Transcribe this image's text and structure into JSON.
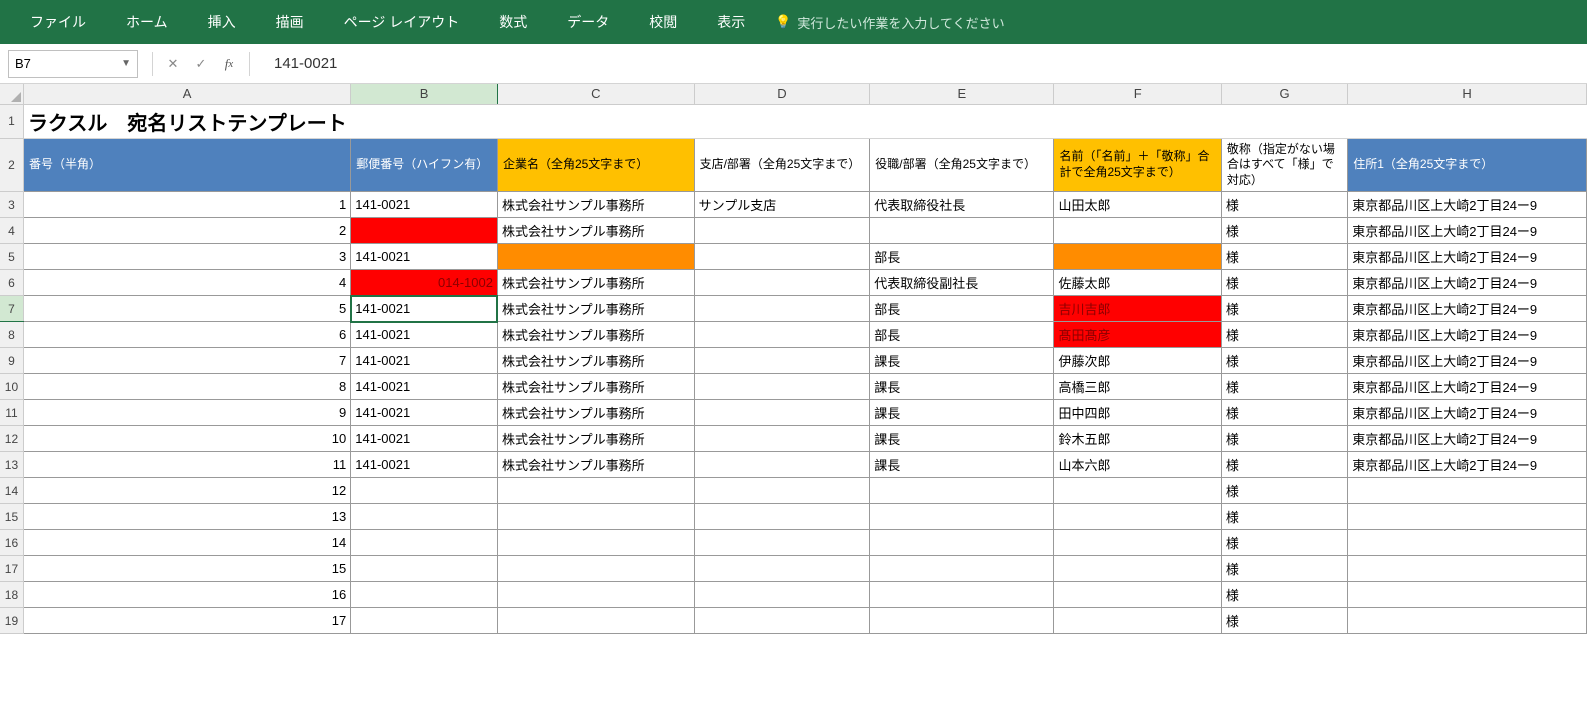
{
  "ribbon": {
    "tabs": [
      "ファイル",
      "ホーム",
      "挿入",
      "描画",
      "ページ レイアウト",
      "数式",
      "データ",
      "校閲",
      "表示"
    ],
    "tellMe": "実行したい作業を入力してください"
  },
  "formulaBar": {
    "nameBox": "B7",
    "formula": "141-0021"
  },
  "columns": [
    "A",
    "B",
    "C",
    "D",
    "E",
    "F",
    "G",
    "H"
  ],
  "selected": {
    "row": 7,
    "col": "B"
  },
  "titleRow": {
    "text": "ラクスル　宛名リストテンプレート"
  },
  "headers": {
    "A": "番号（半角）",
    "B": "郵便番号（ハイフン有）",
    "C": "企業名（全角25文字まで）",
    "D": "支店/部署（全角25文字まで）",
    "E": "役職/部署（全角25文字まで）",
    "F": "名前（「名前」＋「敬称」合計で全角25文字まで）",
    "G": "敬称（指定がない場合はすべて「様」で対応）",
    "H": "住所1（全角25文字まで）"
  },
  "headerStyles": {
    "A": "bg-blue",
    "B": "bg-blue",
    "C": "bg-yellow",
    "D": "",
    "E": "",
    "F": "bg-yellow",
    "G": "",
    "H": "bg-blue"
  },
  "rows": [
    {
      "num": 3,
      "A": "1",
      "B": "141-0021",
      "C": "株式会社サンプル事務所",
      "D": "サンプル支店",
      "E": "代表取締役社長",
      "F": "山田太郎",
      "G": "様",
      "H": "東京都品川区上大崎2丁目24ー9",
      "cls": {}
    },
    {
      "num": 4,
      "A": "2",
      "B": "",
      "C": "株式会社サンプル事務所",
      "D": "",
      "E": "",
      "F": "",
      "G": "様",
      "H": "東京都品川区上大崎2丁目24ー9",
      "cls": {
        "B": "bg-red"
      }
    },
    {
      "num": 5,
      "A": "3",
      "B": "141-0021",
      "C": "",
      "D": "",
      "E": "部長",
      "F": "",
      "G": "様",
      "H": "東京都品川区上大崎2丁目24ー9",
      "cls": {
        "C": "bg-orange",
        "F": "bg-orange"
      }
    },
    {
      "num": 6,
      "A": "4",
      "B": "014-1002",
      "C": "株式会社サンプル事務所",
      "D": "",
      "E": "代表取締役副社長",
      "F": "佐藤太郎",
      "G": "様",
      "H": "東京都品川区上大崎2丁目24ー9",
      "cls": {
        "B": "bg-red txt-darkred right"
      }
    },
    {
      "num": 7,
      "A": "5",
      "B": "141-0021",
      "C": "株式会社サンプル事務所",
      "D": "",
      "E": "部長",
      "F": "吉川吉郎",
      "G": "様",
      "H": "東京都品川区上大崎2丁目24ー9",
      "cls": {
        "F": "bg-red txt-darkred"
      }
    },
    {
      "num": 8,
      "A": "6",
      "B": "141-0021",
      "C": "株式会社サンプル事務所",
      "D": "",
      "E": "部長",
      "F": "髙田髙彦",
      "G": "様",
      "H": "東京都品川区上大崎2丁目24ー9",
      "cls": {
        "F": "bg-red txt-darkred"
      }
    },
    {
      "num": 9,
      "A": "7",
      "B": "141-0021",
      "C": "株式会社サンプル事務所",
      "D": "",
      "E": "課長",
      "F": "伊藤次郎",
      "G": "様",
      "H": "東京都品川区上大崎2丁目24ー9",
      "cls": {}
    },
    {
      "num": 10,
      "A": "8",
      "B": "141-0021",
      "C": "株式会社サンプル事務所",
      "D": "",
      "E": "課長",
      "F": "高橋三郎",
      "G": "様",
      "H": "東京都品川区上大崎2丁目24ー9",
      "cls": {}
    },
    {
      "num": 11,
      "A": "9",
      "B": "141-0021",
      "C": "株式会社サンプル事務所",
      "D": "",
      "E": "課長",
      "F": "田中四郎",
      "G": "様",
      "H": "東京都品川区上大崎2丁目24ー9",
      "cls": {}
    },
    {
      "num": 12,
      "A": "10",
      "B": "141-0021",
      "C": "株式会社サンプル事務所",
      "D": "",
      "E": "課長",
      "F": "鈴木五郎",
      "G": "様",
      "H": "東京都品川区上大崎2丁目24ー9",
      "cls": {}
    },
    {
      "num": 13,
      "A": "11",
      "B": "141-0021",
      "C": "株式会社サンプル事務所",
      "D": "",
      "E": "課長",
      "F": "山本六郎",
      "G": "様",
      "H": "東京都品川区上大崎2丁目24ー9",
      "cls": {}
    },
    {
      "num": 14,
      "A": "12",
      "B": "",
      "C": "",
      "D": "",
      "E": "",
      "F": "",
      "G": "様",
      "H": "",
      "cls": {}
    },
    {
      "num": 15,
      "A": "13",
      "B": "",
      "C": "",
      "D": "",
      "E": "",
      "F": "",
      "G": "様",
      "H": "",
      "cls": {}
    },
    {
      "num": 16,
      "A": "14",
      "B": "",
      "C": "",
      "D": "",
      "E": "",
      "F": "",
      "G": "様",
      "H": "",
      "cls": {}
    },
    {
      "num": 17,
      "A": "15",
      "B": "",
      "C": "",
      "D": "",
      "E": "",
      "F": "",
      "G": "様",
      "H": "",
      "cls": {}
    },
    {
      "num": 18,
      "A": "16",
      "B": "",
      "C": "",
      "D": "",
      "E": "",
      "F": "",
      "G": "様",
      "H": "",
      "cls": {}
    },
    {
      "num": 19,
      "A": "17",
      "B": "",
      "C": "",
      "D": "",
      "E": "",
      "F": "",
      "G": "様",
      "H": "",
      "cls": {}
    }
  ]
}
